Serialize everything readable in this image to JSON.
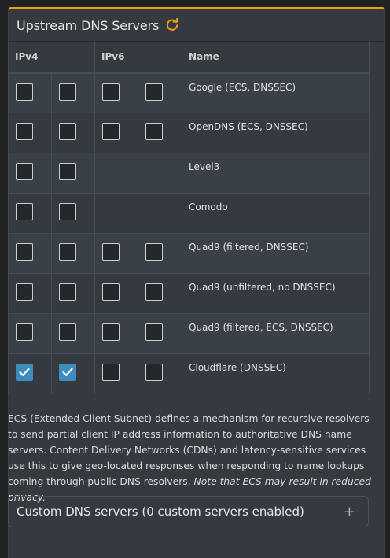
{
  "panel": {
    "title": "Upstream DNS Servers",
    "refresh_icon": "refresh-icon",
    "accent_color": "#f39c12"
  },
  "table": {
    "headers": {
      "ipv4": "IPv4",
      "ipv6": "IPv6",
      "name": "Name"
    },
    "rows": [
      {
        "name": "Google (ECS, DNSSEC)",
        "ipv4": [
          false,
          false
        ],
        "ipv6": [
          false,
          false
        ]
      },
      {
        "name": "OpenDNS (ECS, DNSSEC)",
        "ipv4": [
          false,
          false
        ],
        "ipv6": [
          false,
          false
        ]
      },
      {
        "name": "Level3",
        "ipv4": [
          false,
          false
        ],
        "ipv6": []
      },
      {
        "name": "Comodo",
        "ipv4": [
          false,
          false
        ],
        "ipv6": []
      },
      {
        "name": "Quad9 (filtered, DNSSEC)",
        "ipv4": [
          false,
          false
        ],
        "ipv6": [
          false,
          false
        ]
      },
      {
        "name": "Quad9 (unfiltered, no DNSSEC)",
        "ipv4": [
          false,
          false
        ],
        "ipv6": [
          false,
          false
        ]
      },
      {
        "name": "Quad9 (filtered, ECS, DNSSEC)",
        "ipv4": [
          false,
          false
        ],
        "ipv6": [
          false,
          false
        ]
      },
      {
        "name": "Cloudflare (DNSSEC)",
        "ipv4": [
          true,
          true
        ],
        "ipv6": [
          false,
          false
        ]
      }
    ],
    "checkbox_checked_color": "#3c8dbc"
  },
  "description": {
    "text": "ECS (Extended Client Subnet) defines a mechanism for recursive resolvers to send partial client IP address information to authoritative DNS name servers. Content Delivery Networks (CDNs) and latency-sensitive services use this to give geo-located responses when responding to name lookups coming through public DNS resolvers.",
    "note": "Note that ECS may result in reduced privacy."
  },
  "custom_dns": {
    "label": "Custom DNS servers (0 custom servers enabled)",
    "expand_icon": "plus-icon"
  }
}
